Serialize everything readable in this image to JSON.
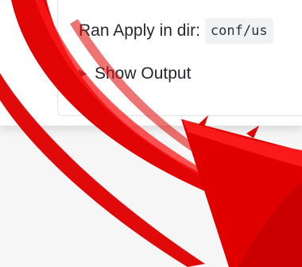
{
  "comment": {
    "ran_prefix": "Ran Apply in dir:",
    "dir_code": "conf/us",
    "show_output_label": "Show Output"
  },
  "annotation": {
    "arrow_color": "#e00000",
    "icon": "red-arrow-icon"
  }
}
